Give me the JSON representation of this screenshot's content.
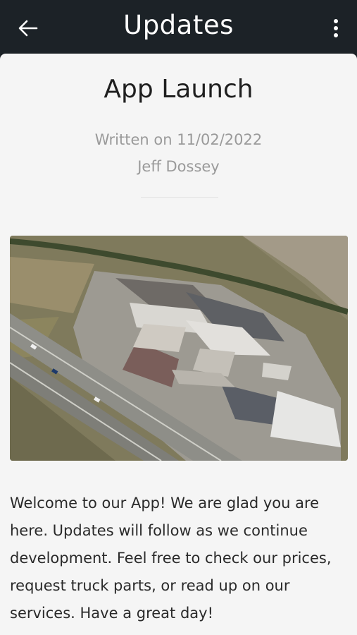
{
  "appbar": {
    "title": "Updates",
    "back_icon": "arrow-left-icon",
    "menu_icon": "more-vertical-icon"
  },
  "post": {
    "title": "App Launch",
    "date": "Written on 11/02/2022",
    "author": "Jeff Dossey",
    "body": "Welcome to our App! We are glad you are here. Updates will follow as we continue development. Feel free to check our prices, request truck parts, or read up on our services. Have a great day!"
  },
  "colors": {
    "appbar_bg": "#1c2227",
    "card_bg": "#f5f5f5",
    "muted_text": "#9a9a9a"
  }
}
